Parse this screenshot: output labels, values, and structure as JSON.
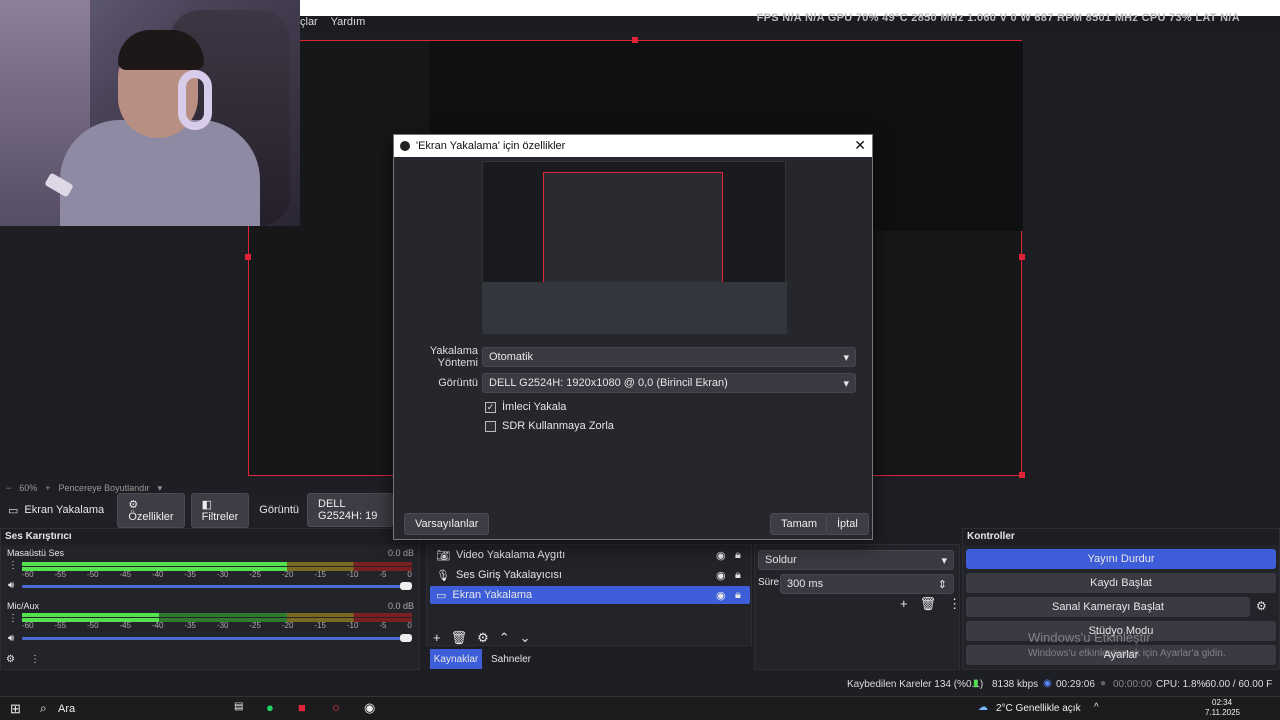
{
  "menubar": {
    "items": [
      "çlar",
      "Yardım"
    ]
  },
  "overlay": {
    "text": "FPS N/A N/A   GPU 70% 49°C 2850 MHz 1.060 V 0 W 687 RPM 8501 MHz   CPU 73%   LAT N/A"
  },
  "dialog": {
    "title": "'Ekran Yakalama' için özellikler",
    "method_label": "Yakalama Yöntemi",
    "method_value": "Otomatik",
    "display_label": "Görüntü",
    "display_value": "DELL G2524H: 1920x1080 @ 0,0 (Birincil Ekran)",
    "cursor_label": "İmleci Yakala",
    "cursor_checked": true,
    "sdr_label": "SDR Kullanmaya Zorla",
    "sdr_checked": false,
    "defaults_button": "Varsayılanlar",
    "ok_button": "Tamam",
    "cancel_button": "İptal"
  },
  "zoombar": {
    "zoom": "60%",
    "fit": "Pencereye Boyutlandır"
  },
  "srcbar": {
    "source_name": "Ekran Yakalama",
    "properties": "Özellikler",
    "filters": "Filtreler",
    "display_label": "Görüntü",
    "display_value": "DELL G2524H: 19"
  },
  "mixer": {
    "title": "Ses Karıştırıcı",
    "channels": [
      {
        "name": "Masaüstü Ses",
        "db": "0.0 dB",
        "level": 0.68
      },
      {
        "name": "Mic/Aux",
        "db": "0.0 dB",
        "level": 0.35
      }
    ],
    "scale": [
      "-60",
      "-55",
      "-50",
      "-45",
      "-40",
      "-35",
      "-30",
      "-25",
      "-20",
      "-15",
      "-10",
      "-5",
      "0"
    ]
  },
  "sources": {
    "items": [
      {
        "name": "Video Yakalama Aygıtı",
        "icon": "camera-icon",
        "selected": false
      },
      {
        "name": "Ses Giriş Yakalayıcısı",
        "icon": "microphone-icon",
        "selected": false
      },
      {
        "name": "Ekran Yakalama",
        "icon": "monitor-icon",
        "selected": true
      }
    ],
    "tab_sources": "Kaynaklar",
    "tab_scenes": "Sahneler"
  },
  "transition": {
    "type": "Soldur",
    "duration_label": "Süre",
    "duration_value": "300 ms"
  },
  "controls": {
    "title": "Kontroller",
    "stop_stream": "Yayını Durdur",
    "start_record": "Kaydı Başlat",
    "virtual_cam": "Sanal Kamerayı Başlat",
    "studio_mode": "Stüdyo Modu",
    "settings": "Ayarlar"
  },
  "watermark": {
    "line1": "Windows'u Etkinleştir",
    "line2": "Windows'u etkinleştirmek için Ayarlar'a gidin."
  },
  "statusbar": {
    "dropped": "Kaybedilen Kareler 134 (%0.1)",
    "bitrate": "8138 kbps",
    "stream_time": "00:29:06",
    "rec_time": "00:00:00",
    "cpu": "CPU: 1.8%",
    "fps": "60.00 / 60.00 F"
  },
  "taskbar": {
    "search": "Ara",
    "weather": "2°C  Genellikle açık",
    "time": "02:34",
    "date": "7.11.2025"
  },
  "colors": {
    "accent": "#3d5ed8",
    "preview_border": "#e0253b"
  }
}
